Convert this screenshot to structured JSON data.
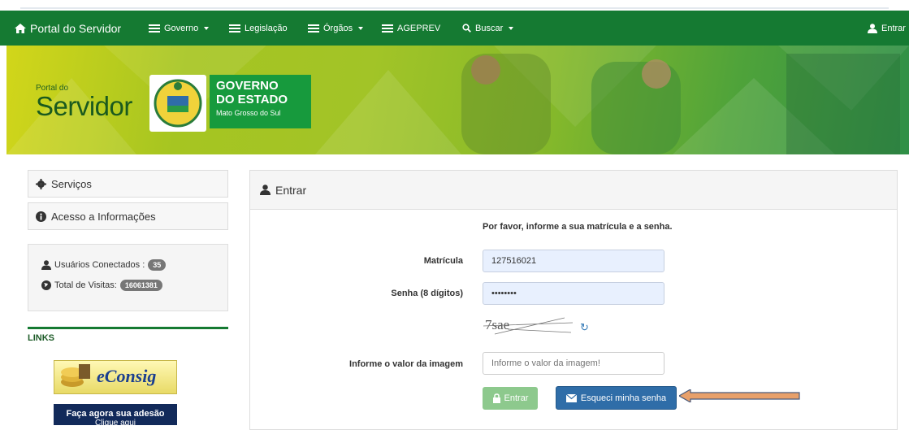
{
  "navbar": {
    "brand": "Portal do Servidor",
    "items": [
      {
        "label": "Governo",
        "icon": "list-icon",
        "dropdown": true
      },
      {
        "label": "Legislação",
        "icon": "list-icon",
        "dropdown": false
      },
      {
        "label": "Órgãos",
        "icon": "list-icon",
        "dropdown": true
      },
      {
        "label": "AGEPREV",
        "icon": "list-icon",
        "dropdown": false
      },
      {
        "label": "Buscar",
        "icon": "search-icon",
        "dropdown": true
      }
    ],
    "login": "Entrar"
  },
  "banner": {
    "portal_small": "Portal do",
    "servidor": "Servidor",
    "gov_line1": "GOVERNO",
    "gov_line2": "DO ESTADO",
    "gov_line3": "Mato Grosso do Sul"
  },
  "sidebar": {
    "servicos": "Serviços",
    "acesso": "Acesso a Informações",
    "usuarios_label": "Usuários Conectados :",
    "usuarios_count": "35",
    "visitas_label": "Total de Visitas:",
    "visitas_count": "16061381",
    "links_heading": "LINKS",
    "econsig_label": "eConsig",
    "adesao_label": "Faça agora sua adesão",
    "adesao_sub": "Clique aqui"
  },
  "login_panel": {
    "title": "Entrar",
    "hint": "Por favor, informe a sua matrícula e a senha.",
    "matricula_label": "Matrícula",
    "matricula_value": "127516021",
    "senha_label": "Senha (8 dígitos)",
    "senha_value": "••••••••",
    "captcha_text": "7sae",
    "captcha_label": "Informe o valor da imagem",
    "captcha_placeholder": "Informe o valor da imagem!",
    "entrar_button": "Entrar",
    "esqueci_button": "Esqueci minha senha"
  },
  "colors": {
    "navbar": "#157a32",
    "button_primary": "#2f6da8",
    "button_success_disabled": "#8dc98d",
    "annotation_arrow": "#e8a06a"
  }
}
